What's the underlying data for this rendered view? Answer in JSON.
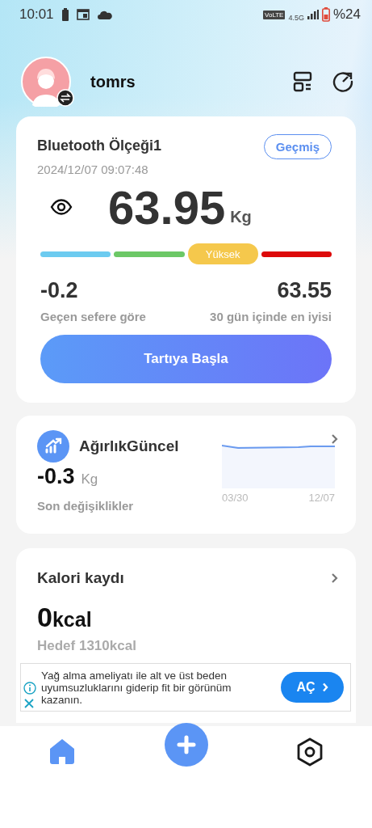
{
  "status_bar": {
    "time": "10:01",
    "network_badge": "VoLTE",
    "network_type": "4.5G",
    "battery": "%24"
  },
  "profile": {
    "username": "tomrs"
  },
  "weight_card": {
    "device": "Bluetooth Ölçeği1",
    "history_button": "Geçmiş",
    "timestamp": "2024/12/07 09:07:48",
    "weight": "63.95",
    "unit": "Kg",
    "scale": [
      {
        "color": "#6ccbf0",
        "selected": false
      },
      {
        "color": "#6cc866",
        "selected": false
      },
      {
        "color": "#f5c84c",
        "selected": true,
        "label": "Yüksek"
      },
      {
        "color": "#dd0a0a",
        "selected": false
      }
    ],
    "stats": [
      {
        "value": "-0.2",
        "label": "Geçen sefere göre"
      },
      {
        "value": "63.55",
        "label": "30 gün içinde en iyisi"
      }
    ],
    "start_button": "Tartıya Başla"
  },
  "trend_card": {
    "title": "AğırlıkGüncel",
    "value": "-0.3",
    "unit": "Kg",
    "caption": "Son değişiklikler",
    "x_labels": [
      "03/30",
      "12/07"
    ]
  },
  "calorie_card": {
    "title": "Kalori kaydı",
    "value": "0",
    "unit": "kcal",
    "goal": "Hedef 1310kcal"
  },
  "ad": {
    "text": "Yağ alma ameliyatı ile alt ve üst beden uyumsuzluklarını giderip fit bir görünüm kazanın.",
    "button": "AÇ"
  },
  "bottom_nav": [
    {
      "kind": "home",
      "selected": true
    },
    {
      "kind": "add",
      "selected": false
    },
    {
      "kind": "settings",
      "selected": false
    }
  ]
}
